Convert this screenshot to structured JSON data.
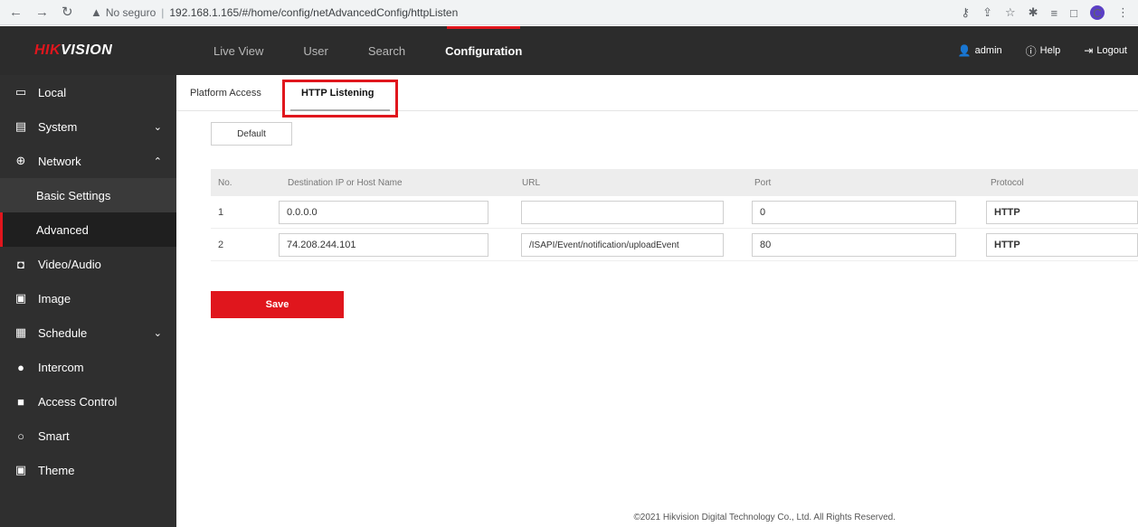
{
  "browser": {
    "security_label": "No seguro",
    "url": "192.168.1.165/#/home/config/netAdvancedConfig/httpListen",
    "profile_initial": "C"
  },
  "header": {
    "logo_prefix": "HIK",
    "logo_suffix": "VISION",
    "nav": [
      "Live View",
      "User",
      "Search",
      "Configuration"
    ],
    "active_nav": "Configuration",
    "user": "admin",
    "help": "Help",
    "logout": "Logout"
  },
  "sidebar": {
    "items": [
      {
        "label": "Local",
        "icon": "monitor-icon"
      },
      {
        "label": "System",
        "icon": "system-icon",
        "chevron": "down"
      },
      {
        "label": "Network",
        "icon": "globe-icon",
        "chevron": "up"
      },
      {
        "label": "Basic Settings",
        "sub": true
      },
      {
        "label": "Advanced",
        "sub": true,
        "active": true
      },
      {
        "label": "Video/Audio",
        "icon": "camera-icon"
      },
      {
        "label": "Image",
        "icon": "image-icon"
      },
      {
        "label": "Schedule",
        "icon": "schedule-icon",
        "chevron": "down"
      },
      {
        "label": "Intercom",
        "icon": "mic-icon"
      },
      {
        "label": "Access Control",
        "icon": "lock-icon"
      },
      {
        "label": "Smart",
        "icon": "bulb-icon"
      },
      {
        "label": "Theme",
        "icon": "theme-icon"
      }
    ]
  },
  "tabs": {
    "platform_access": "Platform Access",
    "http_listening": "HTTP Listening"
  },
  "buttons": {
    "default": "Default",
    "save": "Save"
  },
  "table": {
    "headers": {
      "no": "No.",
      "dest": "Destination IP or Host Name",
      "url": "URL",
      "port": "Port",
      "protocol": "Protocol"
    },
    "rows": [
      {
        "no": "1",
        "dest": "0.0.0.0",
        "url": "",
        "port": "0",
        "protocol": "HTTP"
      },
      {
        "no": "2",
        "dest": "74.208.244.101",
        "url": "/ISAPI/Event/notification/uploadEvent",
        "port": "80",
        "protocol": "HTTP"
      }
    ]
  },
  "footer": "©2021 Hikvision Digital Technology Co., Ltd. All Rights Reserved.",
  "colors": {
    "accent": "#e0161d",
    "topbar": "#2c2c2c",
    "sidebar": "#2f2f2f"
  }
}
